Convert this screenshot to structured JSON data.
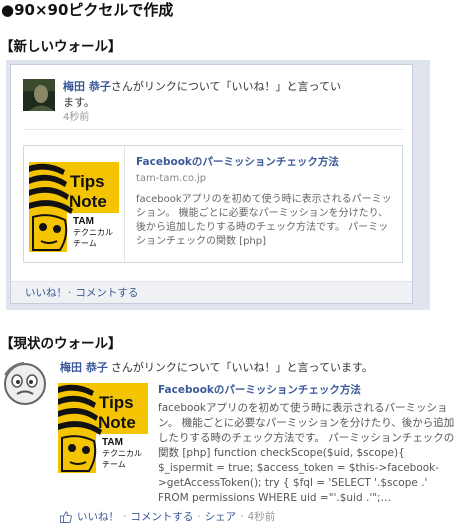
{
  "page": {
    "heading": "●90×90ピクセルで作成"
  },
  "colors": {
    "link": "#3b5998",
    "text": "#333333",
    "muted": "#999999",
    "desc": "#555555",
    "bar": "#eff1f5",
    "yellow": "#f5c400"
  },
  "icons": {
    "like": "thumbs-up-icon"
  },
  "logo": {
    "line1": "Tips",
    "line2": "Note",
    "org": "TAM",
    "dept_line1": "テクニカル",
    "dept_line2": "チーム"
  },
  "new_wall": {
    "section_title": "【新しいウォール】",
    "story": {
      "actor_name": "梅田 恭子",
      "action_text": "さんがリンクについて「いいね！」と言っています。",
      "timestamp": "4秒前"
    },
    "link": {
      "title": "Facebookのパーミッションチェック方法",
      "domain": "tam-tam.co.jp",
      "description": "facebookアプリのを初めて使う時に表示されるパーミッション。 機能ごとに必要なパーミッションを分けたり、後から追加したりする時のチェック方法です。 パーミッションチェックの関数 [php]"
    },
    "actions": {
      "like": "いいね！",
      "separator": "·",
      "comment": "コメントする"
    }
  },
  "current_wall": {
    "section_title": "【現状のウォール】",
    "story": {
      "actor_name": "梅田 恭子",
      "action_text": "さんがリンクについて「いいね！」と言っています。"
    },
    "link": {
      "title": "Facebookのパーミッションチェック方法",
      "description": "facebookアプリのを初めて使う時に表示されるパーミッション。 機能ごとに必要なパーミッションを分けたり、後から追加したりする時のチェック方法です。 パーミッションチェックの関数 [php] function checkScope($uid, $scope){ $_ispermit = true; $access_token = $this->facebook->getAccessToken(); try { $fql = 'SELECT '.$scope .' FROM permissions WHERE uid =\"'.$uid .'\";…"
    },
    "actions": {
      "like": "いいね！",
      "comment": "コメントする",
      "share": "シェア",
      "timestamp": "4秒前",
      "separator": "·"
    }
  }
}
